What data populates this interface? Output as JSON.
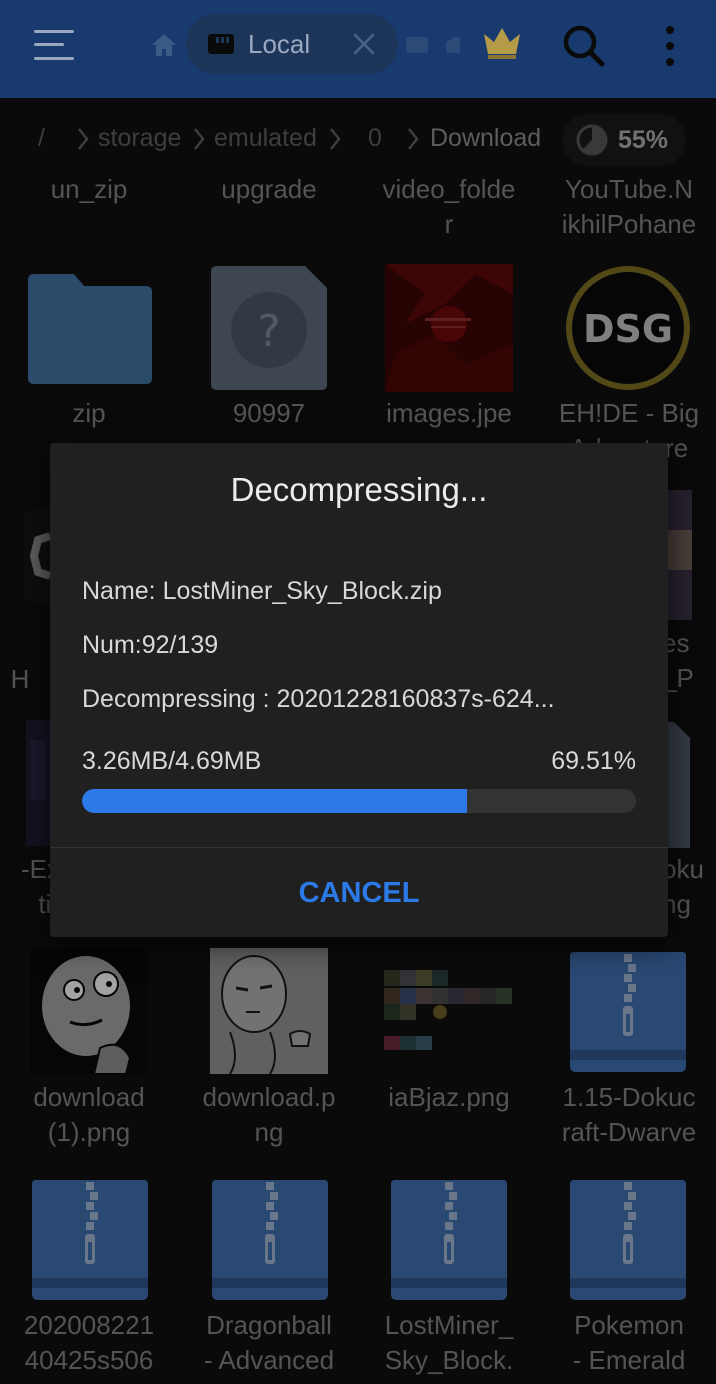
{
  "appbar": {
    "tab_label": "Local",
    "icons": [
      "menu-icon",
      "home-icon",
      "sd-card-icon",
      "close-icon",
      "tab-icon",
      "tab-icon",
      "crown-icon",
      "search-icon",
      "more-vertical-icon"
    ]
  },
  "breadcrumb": {
    "root": "/",
    "items": [
      "storage",
      "emulated",
      "0",
      "Download"
    ],
    "storage_percent": "55%"
  },
  "files": [
    {
      "label": "un_zip"
    },
    {
      "label": "upgrade"
    },
    {
      "label": "video_folde\nr"
    },
    {
      "label": "YouTube.N\nikhilPohane"
    },
    {
      "label": "zip"
    },
    {
      "label": "90997"
    },
    {
      "label": "images.jpe"
    },
    {
      "label": "EH!DE - Big\nAdventure"
    },
    {
      "label": "H"
    },
    {
      "label": "es\n_P"
    },
    {
      "label": "-Ex\ntir"
    },
    {
      "label": "oku\nng"
    },
    {
      "label": "download\n(1).png"
    },
    {
      "label": "download.p\nng"
    },
    {
      "label": "iaBjaz.png"
    },
    {
      "label": "1.15-Dokuc\nraft-Dwarve"
    },
    {
      "label": "202008221\n40425s506"
    },
    {
      "label": "Dragonball\n- Advanced"
    },
    {
      "label": "LostMiner_\nSky_Block."
    },
    {
      "label": "Pokemon\n- Emerald"
    }
  ],
  "dialog": {
    "title": "Decompressing...",
    "name_line": "Name: LostMiner_Sky_Block.zip",
    "num_line": "Num:92/139",
    "current_line": "Decompressing : 20201228160837s-624...",
    "size_line": "3.26MB/4.69MB",
    "percent": "69.51%",
    "progress_fraction": 0.6951,
    "cancel_label": "CANCEL"
  },
  "colors": {
    "appbar": "#183a6e",
    "accent": "#2b7ae8",
    "dialog_bg": "#202020",
    "folder": "#3f6f9c",
    "zip_icon": "#3d6aa8"
  }
}
